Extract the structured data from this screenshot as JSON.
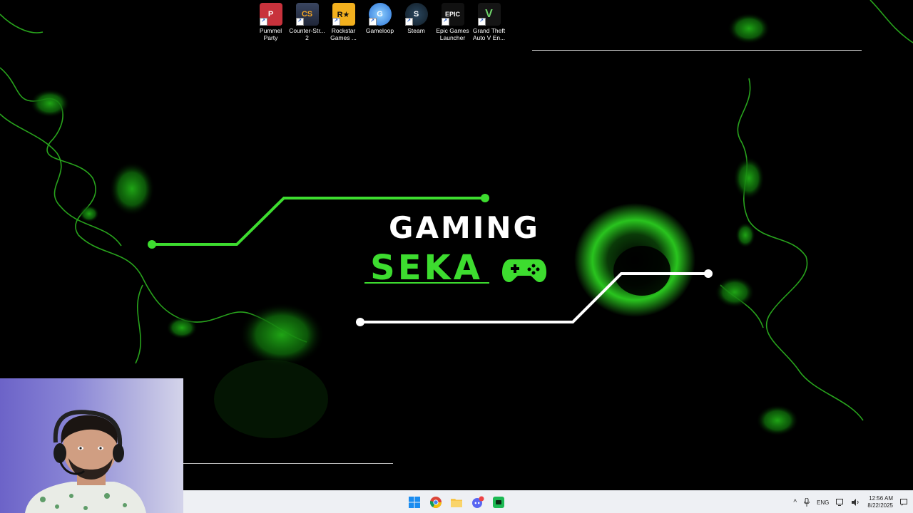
{
  "desktop": {
    "icons": [
      {
        "name": "pummel-party",
        "label": "Pummel\nParty",
        "glyph": "P",
        "color": "#c8323c"
      },
      {
        "name": "counter-strike-2",
        "label": "Counter-Str...\n2",
        "glyph": "CS",
        "color": "#2c3447"
      },
      {
        "name": "rockstar-games",
        "label": "Rockstar\nGames ...",
        "glyph": "R★",
        "color": "#f2b01e"
      },
      {
        "name": "gameloop",
        "label": "Gameloop",
        "glyph": "G",
        "color": "#3a8fe0"
      },
      {
        "name": "steam",
        "label": "Steam",
        "glyph": "S",
        "color": "#1b2838"
      },
      {
        "name": "epic-games-launcher",
        "label": "Epic Games\nLauncher",
        "glyph": "EPIC",
        "color": "#222"
      },
      {
        "name": "gta-v",
        "label": "Grand Theft\nAuto V En...",
        "glyph": "V",
        "color": "#1a1a1a"
      }
    ]
  },
  "wallpaper": {
    "title_top": "GAMING",
    "title_bottom": "SEKA",
    "accent_color": "#3ddc2f",
    "controller_icon": "gamepad-icon"
  },
  "taskbar": {
    "pinned": [
      {
        "name": "start-button",
        "icon": "windows-icon"
      },
      {
        "name": "chrome-button",
        "icon": "chrome-icon"
      },
      {
        "name": "file-explorer-button",
        "icon": "folder-icon"
      },
      {
        "name": "discord-button",
        "icon": "discord-icon"
      },
      {
        "name": "obs-button",
        "icon": "app-icon"
      }
    ],
    "tray": {
      "language": "ENG",
      "time": "12:56 AM",
      "date": "8/22/2025"
    }
  }
}
